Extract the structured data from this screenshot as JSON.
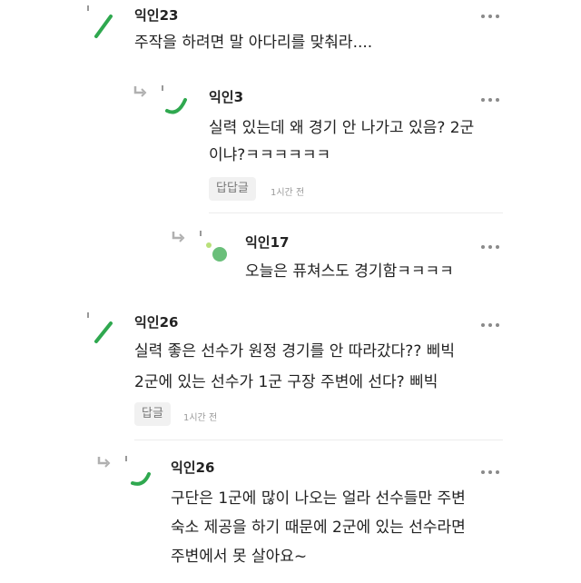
{
  "comments": [
    {
      "author": "익인23",
      "lines": [
        "주작을 하려면 말 아다리를 맞춰라...."
      ]
    },
    {
      "author": "익인3",
      "lines": [
        "실력 있는데 왜 경기 안 나가고 있음? 2군",
        "이냐?ㅋㅋㅋㅋㅋㅋ"
      ],
      "reply_label": "답답글",
      "time": "1시간 전"
    },
    {
      "author": "익인17",
      "lines": [
        "오늘은 퓨쳐스도 경기함ㅋㅋㅋㅋ"
      ]
    },
    {
      "author": "익인26",
      "lines": [
        "실력 좋은 선수가 원정 경기를 안 따라갔다?? 삐빅",
        "2군에 있는 선수가 1군 구장 주변에 선다? 삐빅"
      ],
      "reply_label": "답글",
      "time": "1시간 전"
    },
    {
      "author": "익인26",
      "lines": [
        "구단은 1군에 많이 나오는 얼라 선수들만 주변",
        "숙소 제공을 하기 때문에 2군에 있는 선수라면",
        "주변에서 못 살아요~"
      ]
    }
  ],
  "icons": {
    "more": "more-dots-icon",
    "reply": "reply-arrow-icon",
    "avatar": "anonymous-avatar-icon"
  },
  "colors": {
    "accent": "#2fa84f",
    "avatar_green": "#6abf7a",
    "avatar_light": "#b9e07a"
  }
}
